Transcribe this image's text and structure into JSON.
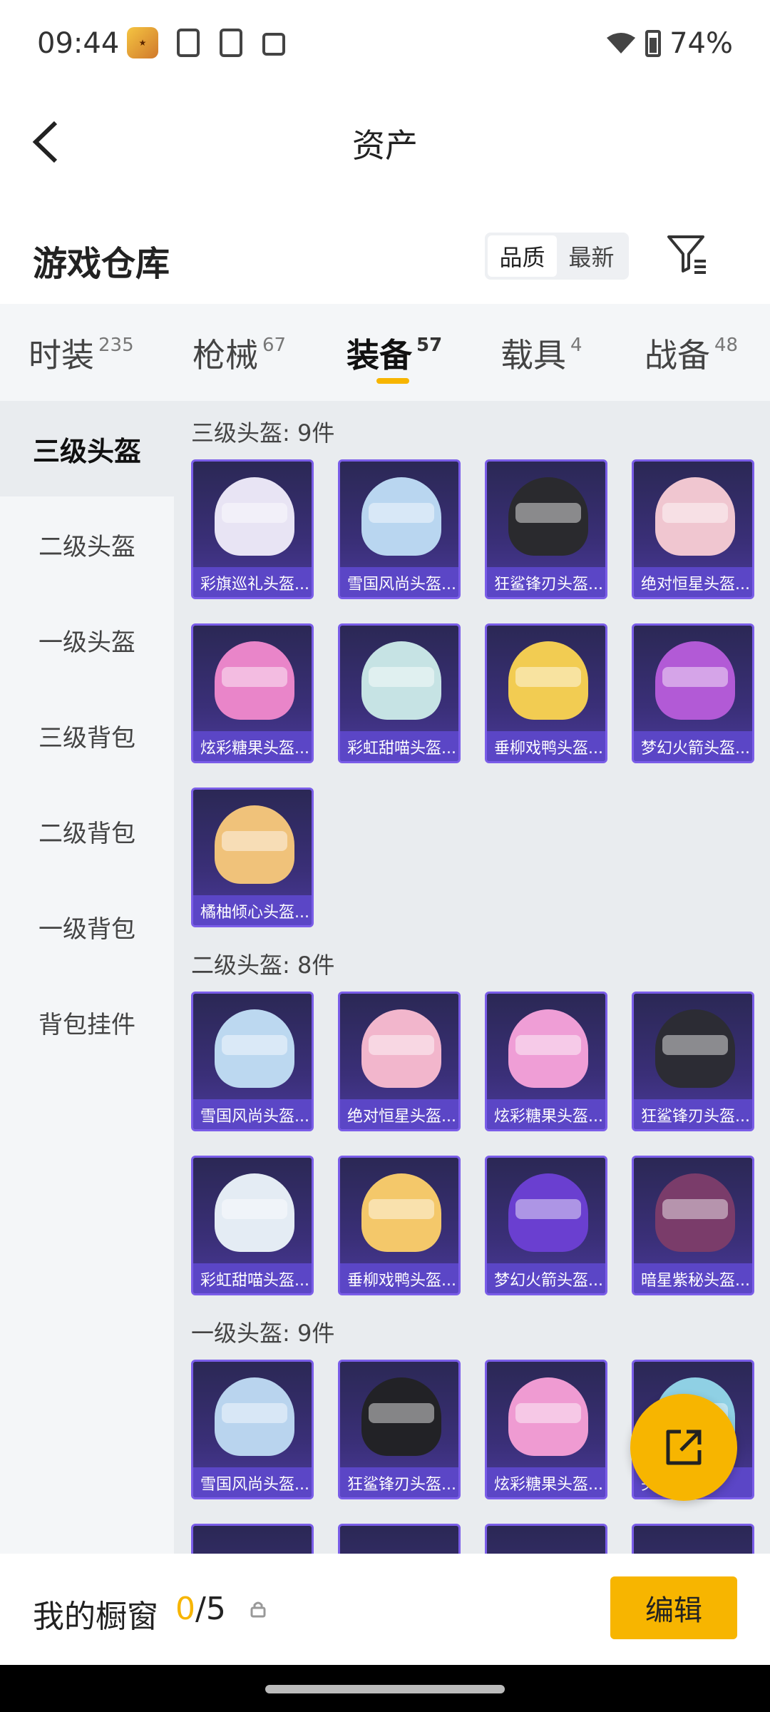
{
  "status_bar": {
    "time": "09:44",
    "battery": "74%"
  },
  "header": {
    "title": "资产"
  },
  "warehouse": {
    "title": "游戏仓库",
    "sort_options": [
      "品质",
      "最新"
    ],
    "active_sort": "品质"
  },
  "tabs": [
    {
      "label": "时装",
      "count": "235"
    },
    {
      "label": "枪械",
      "count": "67"
    },
    {
      "label": "装备",
      "count": "57"
    },
    {
      "label": "载具",
      "count": "4"
    },
    {
      "label": "战备",
      "count": "48"
    }
  ],
  "sidebar": {
    "items": [
      "三级头盔",
      "二级头盔",
      "一级头盔",
      "三级背包",
      "二级背包",
      "一级背包",
      "背包挂件"
    ],
    "active": "三级头盔"
  },
  "sections": [
    {
      "title": "三级头盔: 9件",
      "items": [
        "彩旗巡礼头盔...",
        "雪国风尚头盔...",
        "狂鲨锋刃头盔...",
        "绝对恒星头盔...",
        "炫彩糖果头盔...",
        "彩虹甜喵头盔...",
        "垂柳戏鸭头盔...",
        "梦幻火箭头盔...",
        "橘柚倾心头盔..."
      ]
    },
    {
      "title": "二级头盔: 8件",
      "items": [
        "雪国风尚头盔...",
        "绝对恒星头盔...",
        "炫彩糖果头盔...",
        "狂鲨锋刃头盔...",
        "彩虹甜喵头盔...",
        "垂柳戏鸭头盔...",
        "梦幻火箭头盔...",
        "暗星紫秘头盔..."
      ]
    },
    {
      "title": "一级头盔: 9件",
      "items": [
        "雪国风尚头盔...",
        "狂鲨锋刃头盔...",
        "炫彩糖果头盔...",
        "头盔..."
      ]
    }
  ],
  "bottom_bar": {
    "label": "我的橱窗",
    "count_current": "0",
    "count_total": "/5",
    "edit_label": "编辑"
  },
  "colors": {
    "accent": "#f7b500",
    "card_border": "#7a5de8",
    "card_label_bg": "#5b46c6"
  }
}
